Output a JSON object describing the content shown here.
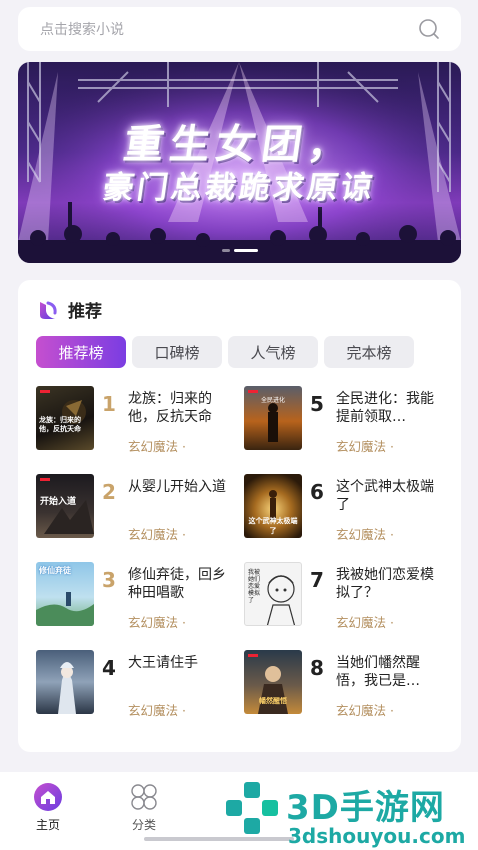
{
  "search": {
    "placeholder": "点击搜索小说",
    "icon": "search-icon"
  },
  "banner": {
    "line1": "重生女团，",
    "line2": "豪门总裁跪求原谅",
    "dots": 2,
    "active_dot": 1
  },
  "recommend": {
    "title": "推荐",
    "tabs": [
      "推荐榜",
      "口碑榜",
      "人气榜",
      "完本榜"
    ],
    "active_tab": 0,
    "books": [
      {
        "rank": "1",
        "name": "龙族：归来的他，反抗天命",
        "genre": "玄幻魔法 ·"
      },
      {
        "rank": "5",
        "name": "全民进化：我能提前领取…",
        "genre": "玄幻魔法 ·"
      },
      {
        "rank": "2",
        "name": "从婴儿开始入道",
        "genre": "玄幻魔法 ·"
      },
      {
        "rank": "6",
        "name": "这个武神太极端了",
        "genre": "玄幻魔法 ·"
      },
      {
        "rank": "3",
        "name": "修仙弃徒，回乡种田唱歌",
        "genre": "玄幻魔法 ·"
      },
      {
        "rank": "7",
        "name": "我被她们恋爱模拟了？",
        "genre": "玄幻魔法 ·"
      },
      {
        "rank": "4",
        "name": "大王请住手",
        "genre": "玄幻魔法 ·"
      },
      {
        "rank": "8",
        "name": "当她们幡然醒悟，我已是…",
        "genre": "玄幻魔法 ·"
      }
    ],
    "cover_text": [
      "龙族：归来的他，反抗天命",
      "全民进化",
      "开始入道",
      "这个武神太极端了",
      "修仙弃徒",
      "我被她们恋爱模拟了",
      "",
      "幡然醒悟"
    ]
  },
  "nav": [
    {
      "label": "主页",
      "icon": "home-icon",
      "active": true
    },
    {
      "label": "分类",
      "icon": "category-icon",
      "active": false
    }
  ],
  "watermark": {
    "brand": "3D手游网",
    "url": "3dshouyou.com"
  },
  "colors": {
    "accent_start": "#c54fcf",
    "accent_end": "#7b3de2",
    "rank_top": "#c9a36a",
    "rank_other": "#222222",
    "genre": "#b49060",
    "watermark": "#1da9a4"
  }
}
